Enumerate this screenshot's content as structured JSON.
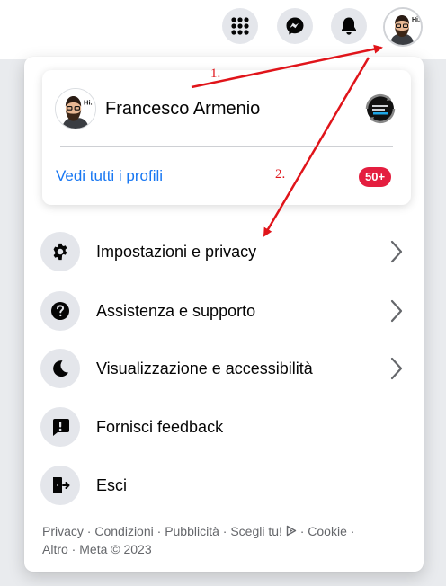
{
  "topbar": {
    "menu_icon": "grid-menu-icon",
    "messenger_icon": "messenger-icon",
    "notifications_icon": "bell-icon",
    "avatar_text": "Hi."
  },
  "profile_card": {
    "name": "Francesco Armenio",
    "avatar_text": "Hi.",
    "see_all": "Vedi tutti i profili",
    "badge": "50+"
  },
  "menu": {
    "items": [
      {
        "label": "Impostazioni e privacy",
        "icon": "gear-icon",
        "chevron": true
      },
      {
        "label": "Assistenza e supporto",
        "icon": "help-icon",
        "chevron": true
      },
      {
        "label": "Visualizzazione e accessibilità",
        "icon": "moon-icon",
        "chevron": true
      },
      {
        "label": "Fornisci feedback",
        "icon": "feedback-icon",
        "chevron": false
      },
      {
        "label": "Esci",
        "icon": "logout-icon",
        "chevron": false
      }
    ]
  },
  "footer": {
    "links": [
      "Privacy",
      "Condizioni",
      "Pubblicità",
      "Scegli tu!",
      "Cookie",
      "Altro"
    ],
    "copyright": "Meta © 2023",
    "separator": " · "
  },
  "annotations": {
    "step1": "1.",
    "step2": "2.",
    "color": "#e0141a"
  },
  "colors": {
    "accent": "#1877f2",
    "badge": "#e41e3f",
    "icon_bg": "#e4e6eb",
    "text_secondary": "#65676b"
  }
}
